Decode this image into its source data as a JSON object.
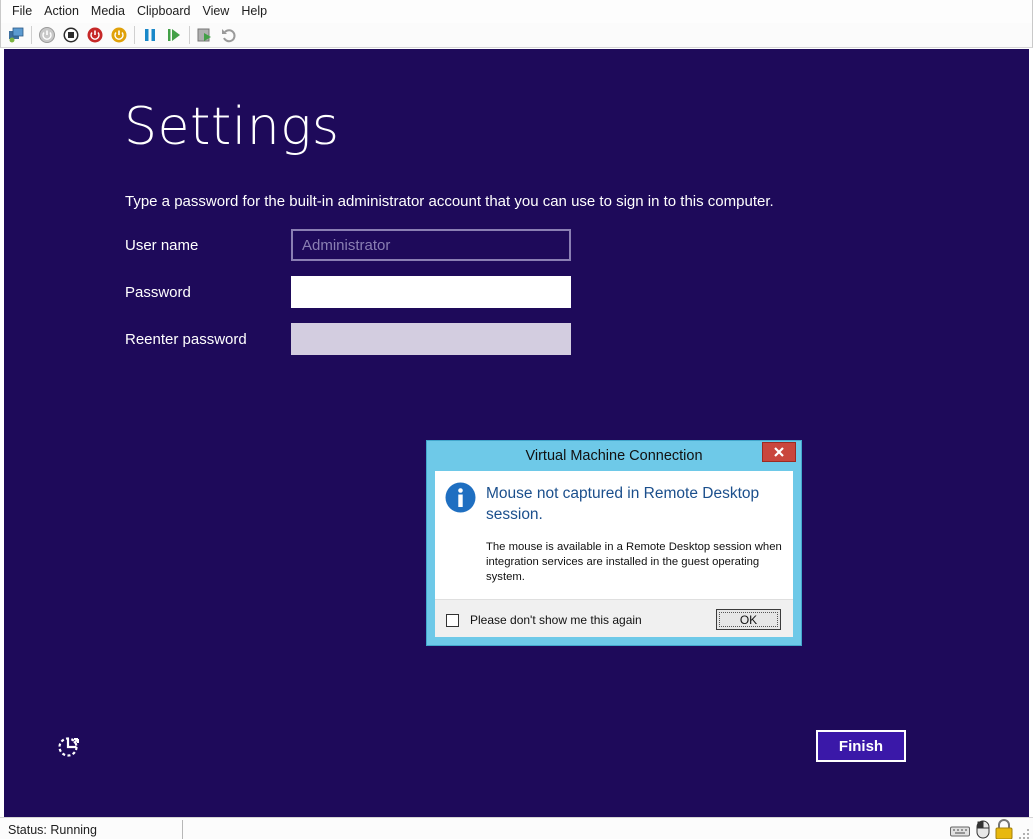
{
  "menubar": {
    "items": [
      "File",
      "Action",
      "Media",
      "Clipboard",
      "View",
      "Help"
    ]
  },
  "toolbar": {
    "icons": [
      "ctrl-alt-del-icon",
      "start-icon",
      "turn-off-icon",
      "shut-down-icon",
      "save-icon",
      "pause-icon",
      "resume-icon",
      "checkpoint-icon",
      "revert-icon"
    ]
  },
  "guest": {
    "title": "Settings",
    "instruction": "Type a password for the built-in administrator account that you can use to sign in to this computer.",
    "username_label": "User name",
    "username_value": "Administrator",
    "password_label": "Password",
    "reenter_label": "Reenter password",
    "finish_label": "Finish",
    "background_color": "#1e0a5a"
  },
  "dialog": {
    "title": "Virtual Machine Connection",
    "heading": "Mouse not captured in Remote Desktop session.",
    "message": "The mouse is available in a Remote Desktop session when integration services are installed in the guest operating system.",
    "checkbox_label": "Please don't show me this again",
    "ok_label": "OK"
  },
  "statusbar": {
    "status": "Status: Running"
  }
}
